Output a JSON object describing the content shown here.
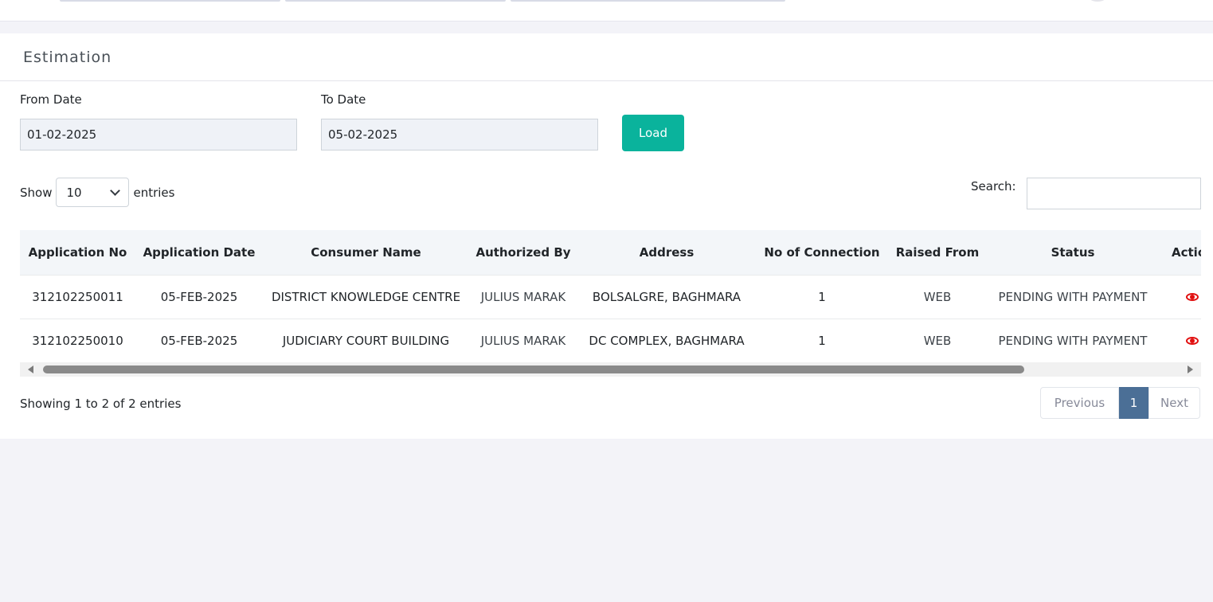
{
  "page": {
    "title": "Estimation"
  },
  "filters": {
    "from_date_label": "From Date",
    "from_date_value": "01-02-2025",
    "to_date_label": "To Date",
    "to_date_value": "05-02-2025",
    "load_label": "Load"
  },
  "table_controls": {
    "show_label": "Show",
    "entries_label": "entries",
    "page_length": "10",
    "search_label": "Search:",
    "search_value": ""
  },
  "table": {
    "columns": [
      "Application No",
      "Application Date",
      "Consumer Name",
      "Authorized By",
      "Address",
      "No of Connection",
      "Raised From",
      "Status",
      "Action"
    ],
    "rows": [
      {
        "application_no": "312102250011",
        "application_date": "05-FEB-2025",
        "consumer_name": "DISTRICT KNOWLEDGE CENTRE",
        "authorized_by": "JULIUS MARAK",
        "address": "BOLSALGRE, BAGHMARA",
        "connections": "1",
        "raised_from": "WEB",
        "status": "PENDING WITH PAYMENT",
        "action_icon": "eye-icon"
      },
      {
        "application_no": "312102250010",
        "application_date": "05-FEB-2025",
        "consumer_name": "JUDICIARY COURT BUILDING",
        "authorized_by": "JULIUS MARAK",
        "address": "DC COMPLEX, BAGHMARA",
        "connections": "1",
        "raised_from": "WEB",
        "status": "PENDING WITH PAYMENT",
        "action_icon": "eye-icon"
      }
    ]
  },
  "footer": {
    "info": "Showing 1 to 2 of 2 entries",
    "previous_label": "Previous",
    "current_page": "1",
    "next_label": "Next"
  },
  "colors": {
    "accent": "#0ab39c",
    "pager_active": "#4b6f96",
    "action_icon": "#e10f0f"
  }
}
